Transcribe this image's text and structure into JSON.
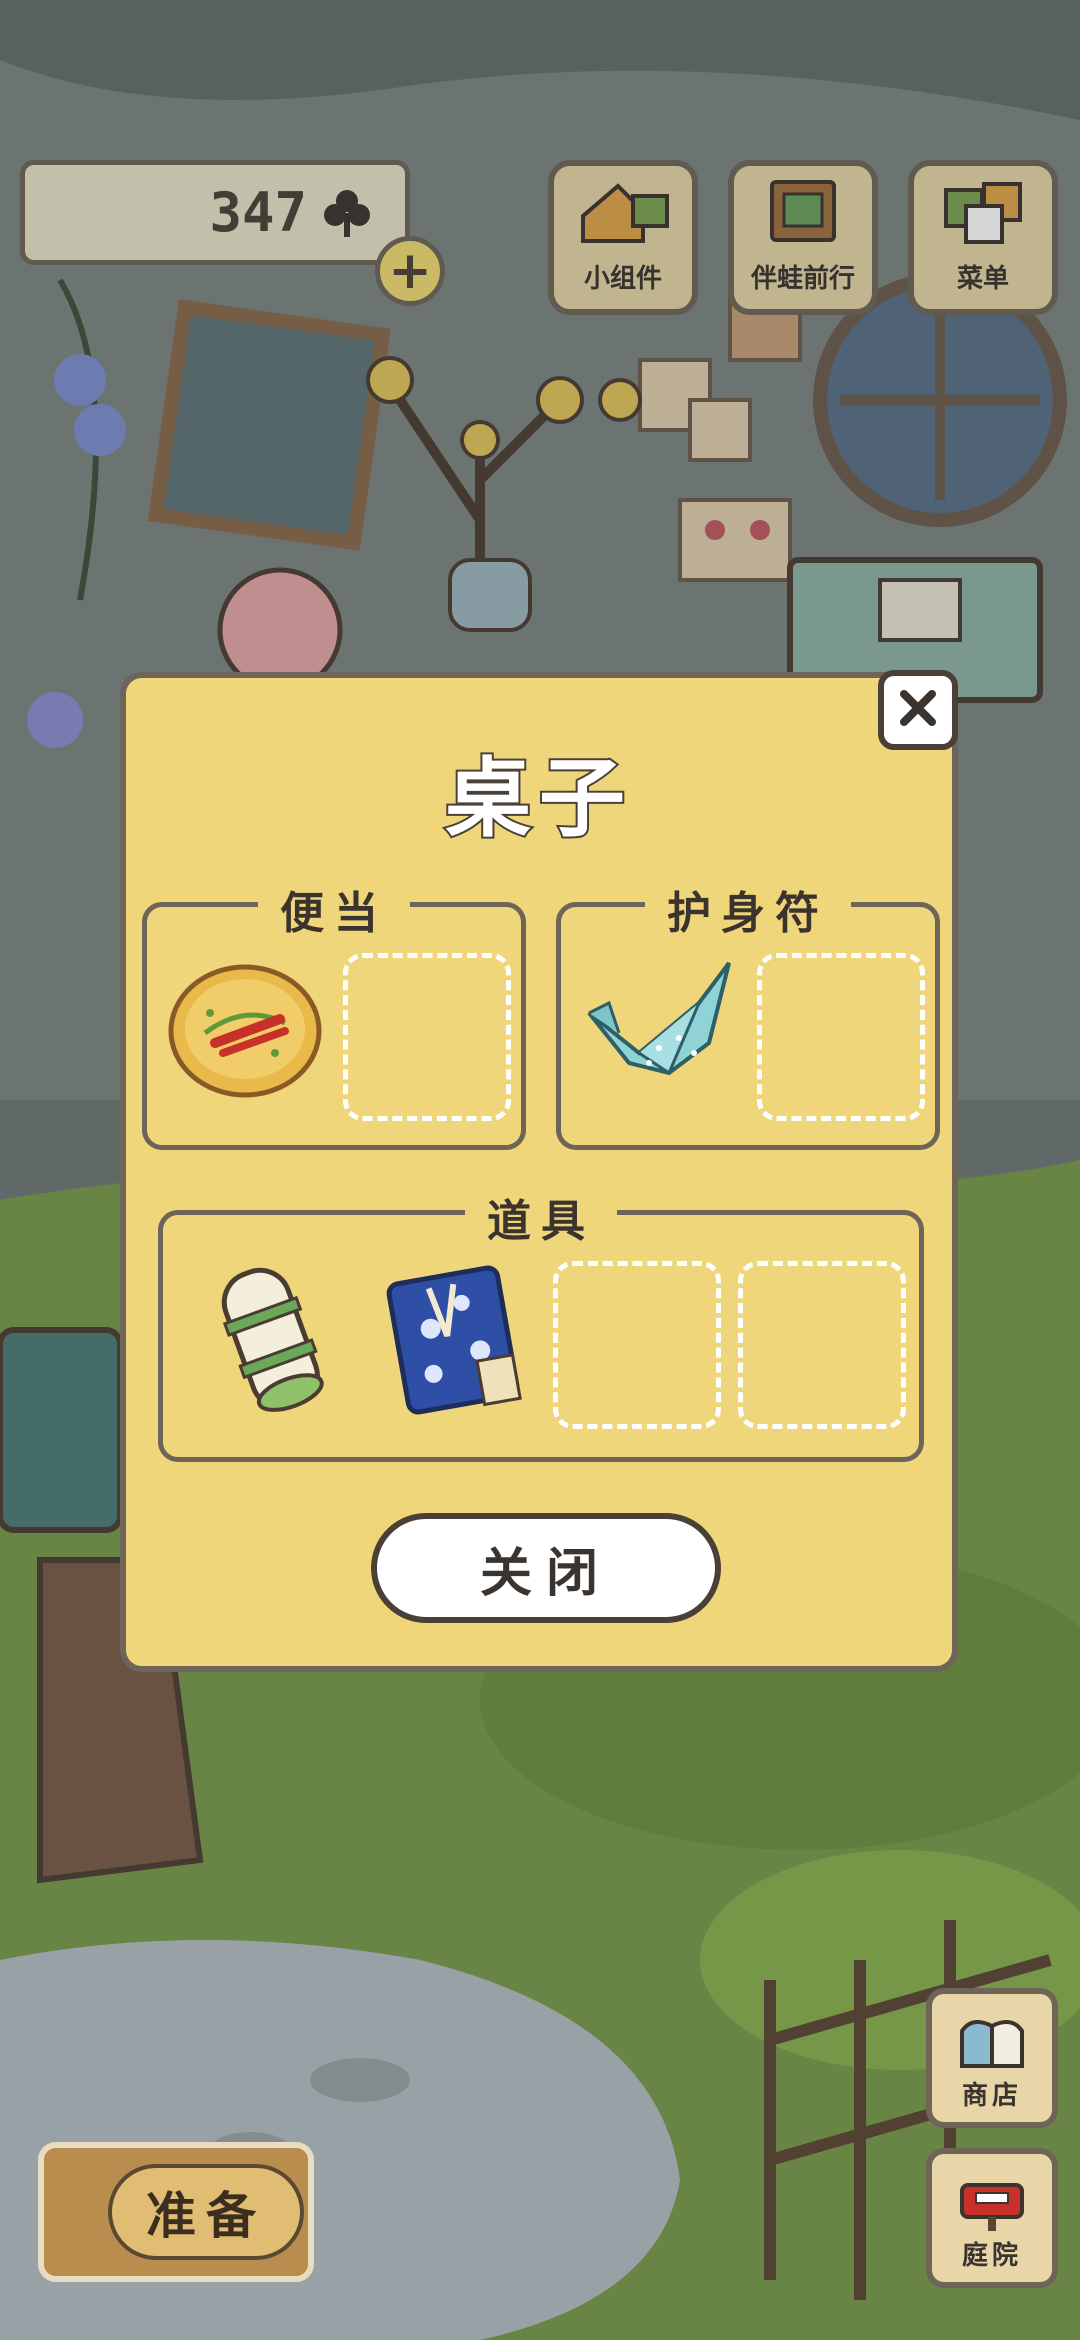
{
  "hud": {
    "clover_count": "347",
    "top_buttons": [
      {
        "label": "小组件",
        "icon": "widget-icon"
      },
      {
        "label": "伴蛙前行",
        "icon": "album-icon"
      },
      {
        "label": "菜单",
        "icon": "menu-cards-icon"
      }
    ]
  },
  "modal": {
    "title": "桌子",
    "sections": {
      "bento": {
        "label": "便当",
        "items": [
          "pancake-bento"
        ],
        "empty_slots": 1
      },
      "charm": {
        "label": "护身符",
        "items": [
          "paper-crane"
        ],
        "empty_slots": 1
      },
      "tools": {
        "label": "道具",
        "items": [
          "rolled-mat",
          "blue-cloth-bag"
        ],
        "empty_slots": 2
      }
    },
    "close_button": "关闭"
  },
  "bottom": {
    "prepare_button": "准备",
    "shop_button": "商店",
    "yard_button": "庭院"
  },
  "colors": {
    "modal_bg": "#f0d67a",
    "outline": "#6e6458",
    "button_bg": "#e8d6a8",
    "ground": "#7a9a4a"
  }
}
